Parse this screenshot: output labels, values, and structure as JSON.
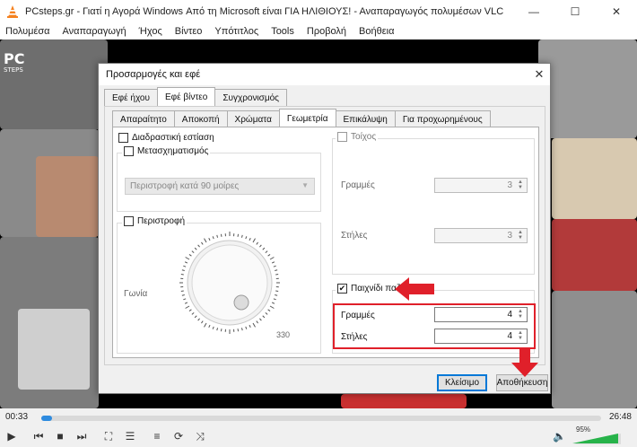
{
  "window": {
    "title": "PCsteps.gr - Γιατί η Αγορά Windows Από τη Microsoft είναι ΓΙΑ ΗΛΙΘΙΟΥΣ! - Αναπαραγωγός πολυμέσων VLC",
    "min_glyph": "—",
    "max_glyph": "☐",
    "close_glyph": "✕"
  },
  "menu": [
    "Πολυμέσα",
    "Αναπαραγωγή",
    "Ήχος",
    "Βίντεο",
    "Υπότιτλος",
    "Tools",
    "Προβολή",
    "Βοήθεια"
  ],
  "dialog": {
    "title": "Προσαρμογές και εφέ",
    "close_glyph": "✕",
    "main_tabs": [
      "Εφέ ήχου",
      "Εφέ βίντεο",
      "Συγχρονισμός"
    ],
    "sub_tabs": [
      "Απαραίτητο",
      "Αποκοπή",
      "Χρώματα",
      "Γεωμετρία",
      "Επικάλυψη",
      "Για προχωρημένους"
    ],
    "interactive_zoom": {
      "label": "Διαδραστική εστίαση",
      "checked": false
    },
    "transform": {
      "label": "Μετασχηματισμός",
      "checked": false,
      "select_value": "Περιστροφή κατά 90 μοίρες"
    },
    "rotate": {
      "label": "Περιστροφή",
      "checked": false,
      "angle_label": "Γωνία",
      "dial_value": "330"
    },
    "wall": {
      "label": "Τοίχος",
      "checked": false,
      "rows_label": "Γραμμές",
      "rows_value": "3",
      "cols_label": "Στήλες",
      "cols_value": "3"
    },
    "puzzle": {
      "label": "Παιχνίδι παζλ",
      "checked": true,
      "check_glyph": "✔",
      "rows_label": "Γραμμές",
      "rows_value": "4",
      "cols_label": "Στήλες",
      "cols_value": "4"
    },
    "close_button": "Κλείσιμο",
    "save_button": "Αποθήκευση"
  },
  "player": {
    "elapsed": "00:33",
    "total": "26:48",
    "progress": 0.02,
    "volume": "95%",
    "accent": "#2e8bdf",
    "volume_color": "#27b34a",
    "annotation_color": "#e0202a"
  },
  "logo": {
    "line1": "PC",
    "line2": "STEPS"
  }
}
